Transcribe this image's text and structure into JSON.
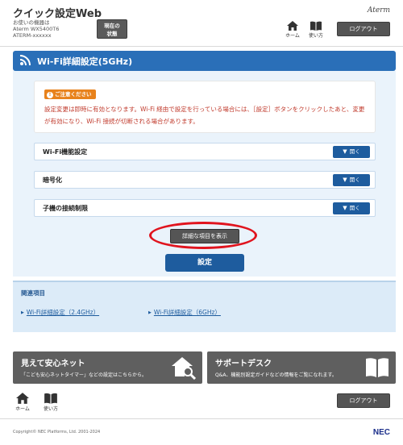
{
  "header": {
    "app_title": "クイック設定Web",
    "device_label": "お使いの機器は",
    "device_model": "Aterm WX5400T6",
    "device_id": "ATERM-xxxxxx",
    "status_button": "現在の\n状態",
    "brand": "Aterm",
    "home_label": "ホーム",
    "help_label": "使い方",
    "logout_label": "ログアウト"
  },
  "page": {
    "title": "Wi-Fi詳細設定(5GHz)"
  },
  "notice": {
    "badge": "ご注意ください",
    "badge_icon": "!",
    "text": "設定変更は即時に有効となります。Wi-Fi 経由で設定を行っている場合には、［設定］ボタンをクリックしたあと、変更が有効になり、Wi-Fi 接続が切断される場合があります。"
  },
  "sections": [
    {
      "label": "Wi-Fi機能設定",
      "button": "開く"
    },
    {
      "label": "暗号化",
      "button": "開く"
    },
    {
      "label": "子機の接続制限",
      "button": "開く"
    }
  ],
  "actions": {
    "detail_button": "詳細な項目を表示",
    "set_button": "設定"
  },
  "related": {
    "title": "関連項目",
    "links": [
      "Wi-Fi詳細設定（2.4GHz）",
      "Wi-Fi詳細設定（6GHz）"
    ]
  },
  "banners": [
    {
      "title": "見えて安心ネット",
      "sub": "「こども安心ネットタイマー」などの設定はこちらから。",
      "icon": "home-search-icon"
    },
    {
      "title": "サポートデスク",
      "sub": "Q&A、機能別設定ガイドなどの情報をご覧になれます。",
      "icon": "book-icon"
    }
  ],
  "footer": {
    "home_label": "ホーム",
    "help_label": "使い方",
    "logout_label": "ログアウト",
    "copyright": "Copyright© NEC Platforms, Ltd. 2001-2024",
    "logo": "NEC"
  },
  "colors": {
    "accent_blue": "#2a6fb8",
    "button_blue": "#1e5c9e",
    "notice_orange": "#e8821c",
    "notice_text_red": "#c0392b",
    "highlight_red": "#e0141e",
    "dark_gray": "#555555"
  }
}
